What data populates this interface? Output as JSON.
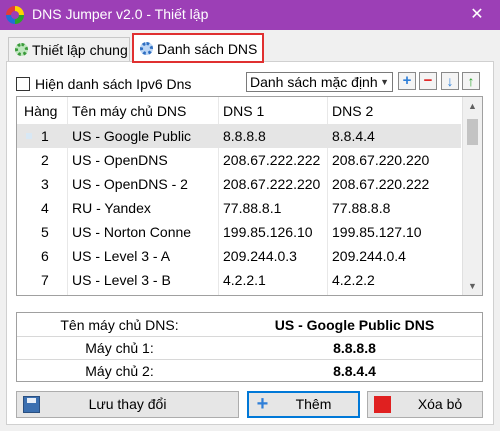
{
  "window": {
    "title": "DNS Jumper v2.0 - Thiết lập",
    "close_glyph": "✕"
  },
  "tabs": [
    {
      "label": "Thiết lập chung",
      "icon": "gear-icon",
      "active": false
    },
    {
      "label": "Danh sách DNS",
      "icon": "gear-icon",
      "active": true
    }
  ],
  "options": {
    "ipv6_label": "Hiện danh sách Ipv6 Dns",
    "ipv6_checked": false,
    "list_select_value": "Danh sách mặc định"
  },
  "table": {
    "headers": [
      "Hàng",
      "Tên máy chủ DNS",
      "DNS 1",
      "DNS 2"
    ],
    "rows": [
      {
        "idx": "1",
        "name": "US - Google Public",
        "dns1": "8.8.8.8",
        "dns2": "8.8.4.4"
      },
      {
        "idx": "2",
        "name": "US - OpenDNS",
        "dns1": "208.67.222.222",
        "dns2": "208.67.220.220"
      },
      {
        "idx": "3",
        "name": "US - OpenDNS - 2",
        "dns1": "208.67.222.220",
        "dns2": "208.67.220.222"
      },
      {
        "idx": "4",
        "name": "RU - Yandex",
        "dns1": "77.88.8.1",
        "dns2": "77.88.8.8"
      },
      {
        "idx": "5",
        "name": "US - Norton Conne",
        "dns1": "199.85.126.10",
        "dns2": "199.85.127.10"
      },
      {
        "idx": "6",
        "name": "US - Level 3 - A",
        "dns1": "209.244.0.3",
        "dns2": "209.244.0.4"
      },
      {
        "idx": "7",
        "name": "US - Level 3 - B",
        "dns1": "4.2.2.1",
        "dns2": "4.2.2.2"
      }
    ],
    "selected_row": 0
  },
  "details": {
    "name_label": "Tên máy chủ DNS:",
    "name_value": "US - Google Public DNS",
    "dns1_label": "Máy chủ 1:",
    "dns1_value": "8.8.8.8",
    "dns2_label": "Máy chủ 2:",
    "dns2_value": "8.8.4.4"
  },
  "buttons": {
    "save": "Lưu thay đổi",
    "add": "Thêm",
    "delete": "Xóa bỏ"
  },
  "colors": {
    "titlebar": "#9c3fb6",
    "active_tab_border": "#e03030",
    "accent": "#0078d7"
  }
}
